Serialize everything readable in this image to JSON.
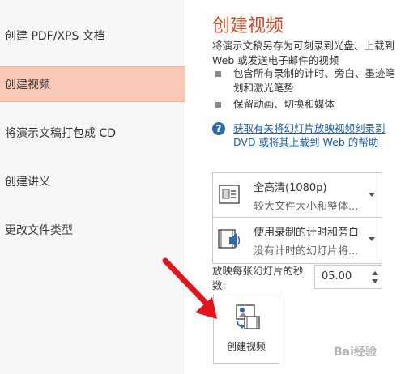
{
  "nav": {
    "items": [
      {
        "label": "创建 PDF/XPS 文档"
      },
      {
        "label": "创建视频"
      },
      {
        "label": "将演示文稿打包成 CD"
      },
      {
        "label": "创建讲义"
      },
      {
        "label": "更改文件类型"
      }
    ],
    "selected_index": 1
  },
  "content": {
    "title": "创建视频",
    "description": "将演示文稿另存为可刻录到光盘、上载到 Web 或发送电子邮件的视频",
    "bullets": [
      "包含所有录制的计时、旁白、墨迹笔划和激光笔势",
      "保留动画、切换和媒体"
    ],
    "help_link": "获取有关将幻灯片放映视频刻录到 DVD 或将其上载到 Web 的帮助"
  },
  "quality_dropdown": {
    "main": "全高清(1080p)",
    "sub": "较大文件大小和整体..."
  },
  "timing_dropdown": {
    "main": "使用录制的计时和旁白",
    "sub": "没有计时的幻灯片将..."
  },
  "seconds": {
    "label": "放映每张幻灯片的秒数:",
    "value": "05.00"
  },
  "create_button": {
    "label": "创建视频"
  },
  "watermark": "Bai经验",
  "colors": {
    "accent": "#d24726",
    "selected_bg": "#f8c9b4",
    "link": "#1c5aa8",
    "arrow": "#e3141a"
  },
  "icons": [
    "video-quality-icon",
    "narration-speaker-icon",
    "create-video-icon",
    "help-icon"
  ]
}
